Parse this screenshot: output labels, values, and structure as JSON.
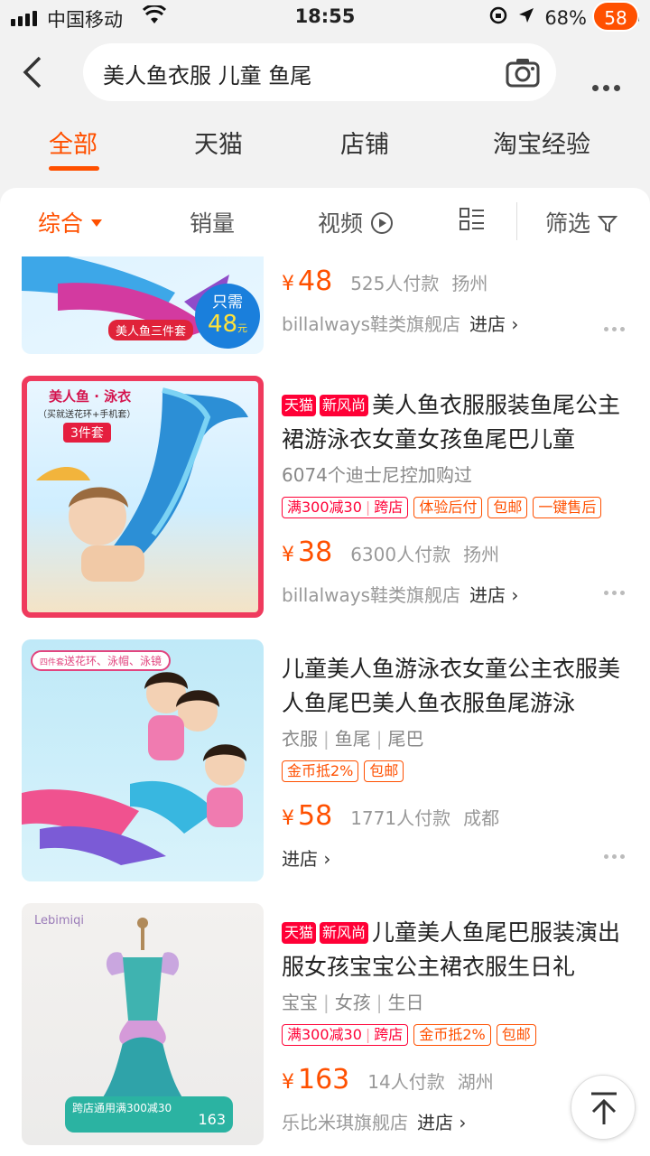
{
  "status_bar": {
    "carrier": "中国移动",
    "time": "18:55",
    "battery": "68%",
    "battery_level": 0.68
  },
  "search": {
    "query": "美人鱼衣服 儿童 鱼尾",
    "cart_count": "58"
  },
  "tabs": [
    {
      "label": "全部"
    },
    {
      "label": "天猫"
    },
    {
      "label": "店铺"
    },
    {
      "label": "淘宝经验"
    }
  ],
  "sort_bar": {
    "comprehensive": "综合",
    "sales": "销量",
    "video": "视频",
    "filter": "筛选"
  },
  "products": [
    {
      "thumb_caption": "美人鱼三件套",
      "thumb_badge_top": "只需",
      "thumb_badge_price": "48",
      "thumb_badge_unit": "元",
      "currency": "¥",
      "price": "48",
      "sales": "525人付款",
      "location": "扬州",
      "shop": "billalways鞋类旗舰店",
      "enter": "进店"
    },
    {
      "thumb_title": "美人鱼 · 泳衣",
      "thumb_sub": "（买就送花环+手机套）",
      "thumb_badge": "3件套",
      "tags": [
        "天猫",
        "新风尚"
      ],
      "title": "美人鱼衣服服装鱼尾公主裙游泳衣女童女孩鱼尾巴儿童",
      "attrs_text": "6074个迪士尼控加购过",
      "promo_a": "满300减30",
      "promo_b": "跨店",
      "promos": [
        "体验后付",
        "包邮",
        "一键售后"
      ],
      "currency": "¥",
      "price": "38",
      "sales": "6300人付款",
      "location": "扬州",
      "shop": "billalways鞋类旗舰店",
      "enter": "进店"
    },
    {
      "thumb_label": "四件套",
      "thumb_text": "送花环、泳帽、泳镜",
      "title": "儿童美人鱼游泳衣女童公主衣服美人鱼尾巴美人鱼衣服鱼尾游泳",
      "attrs": [
        "衣服",
        "鱼尾",
        "尾巴"
      ],
      "promos": [
        "金币抵2%",
        "包邮"
      ],
      "currency": "¥",
      "price": "58",
      "sales": "1771人付款",
      "location": "成都",
      "enter": "进店"
    },
    {
      "thumb_brand": "Lebimiqi",
      "thumb_promo": "跨店通用满300减30",
      "thumb_price": "163",
      "tags": [
        "天猫",
        "新风尚"
      ],
      "title": "儿童美人鱼尾巴服装演出服女孩宝宝公主裙衣服生日礼",
      "attrs": [
        "宝宝",
        "女孩",
        "生日"
      ],
      "promo_a": "满300减30",
      "promo_b": "跨店",
      "promos": [
        "金币抵2%",
        "包邮"
      ],
      "currency": "¥",
      "price": "163",
      "sales": "14人付款",
      "location": "湖州",
      "shop": "乐比米琪旗舰店",
      "enter": "进店"
    }
  ],
  "colors": {
    "accent": "#ff5000",
    "tmall": "#ff0036"
  }
}
